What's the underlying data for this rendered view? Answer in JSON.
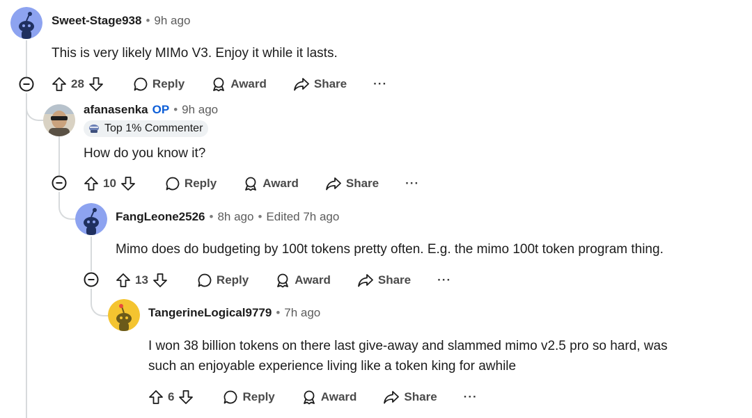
{
  "comments": [
    {
      "username": "Sweet-Stage938",
      "op": "",
      "time": "9h ago",
      "edited": "",
      "flair": "",
      "body": [
        "This is very likely MIMo V3. Enjoy it while it lasts."
      ],
      "votes": "28",
      "avatar_color": "#8da3f0"
    },
    {
      "username": "afanasenka",
      "op": "OP",
      "time": "9h ago",
      "edited": "",
      "flair": "Top 1% Commenter",
      "body": [
        "How do you know it?"
      ],
      "votes": "10",
      "avatar_color": "#9a8a6a"
    },
    {
      "username": "FangLeone2526",
      "op": "",
      "time": "8h ago",
      "edited": "Edited 7h ago",
      "flair": "",
      "body": [
        "Mimo does do budgeting by 100t tokens pretty often. E.g. the mimo 100t token program thing."
      ],
      "votes": "13",
      "avatar_color": "#8da3f0"
    },
    {
      "username": "TangerineLogical9779",
      "op": "",
      "time": "7h ago",
      "edited": "",
      "flair": "",
      "body": [
        "I won 38 billion tokens on there last give-away and slammed mimo v2.5 pro so hard, was",
        "such an enjoyable experience living like a token king for awhile"
      ],
      "votes": "6",
      "avatar_color": "#f4c430"
    }
  ],
  "actions": {
    "reply": "Reply",
    "award": "Award",
    "share": "Share",
    "more": "···",
    "separator": "•"
  },
  "colors": {
    "text": "#1c1c1c",
    "muted": "#5c5c5c",
    "op": "#0e5fd8",
    "thread_line": "#d7dadc",
    "flair_bg": "#eef1f3"
  },
  "icons": [
    "upvote-icon",
    "downvote-icon",
    "reply-bubble-icon",
    "award-icon",
    "share-arrow-icon",
    "collapse-minus-icon",
    "snoo-avatar",
    "trophy-flair-icon"
  ]
}
